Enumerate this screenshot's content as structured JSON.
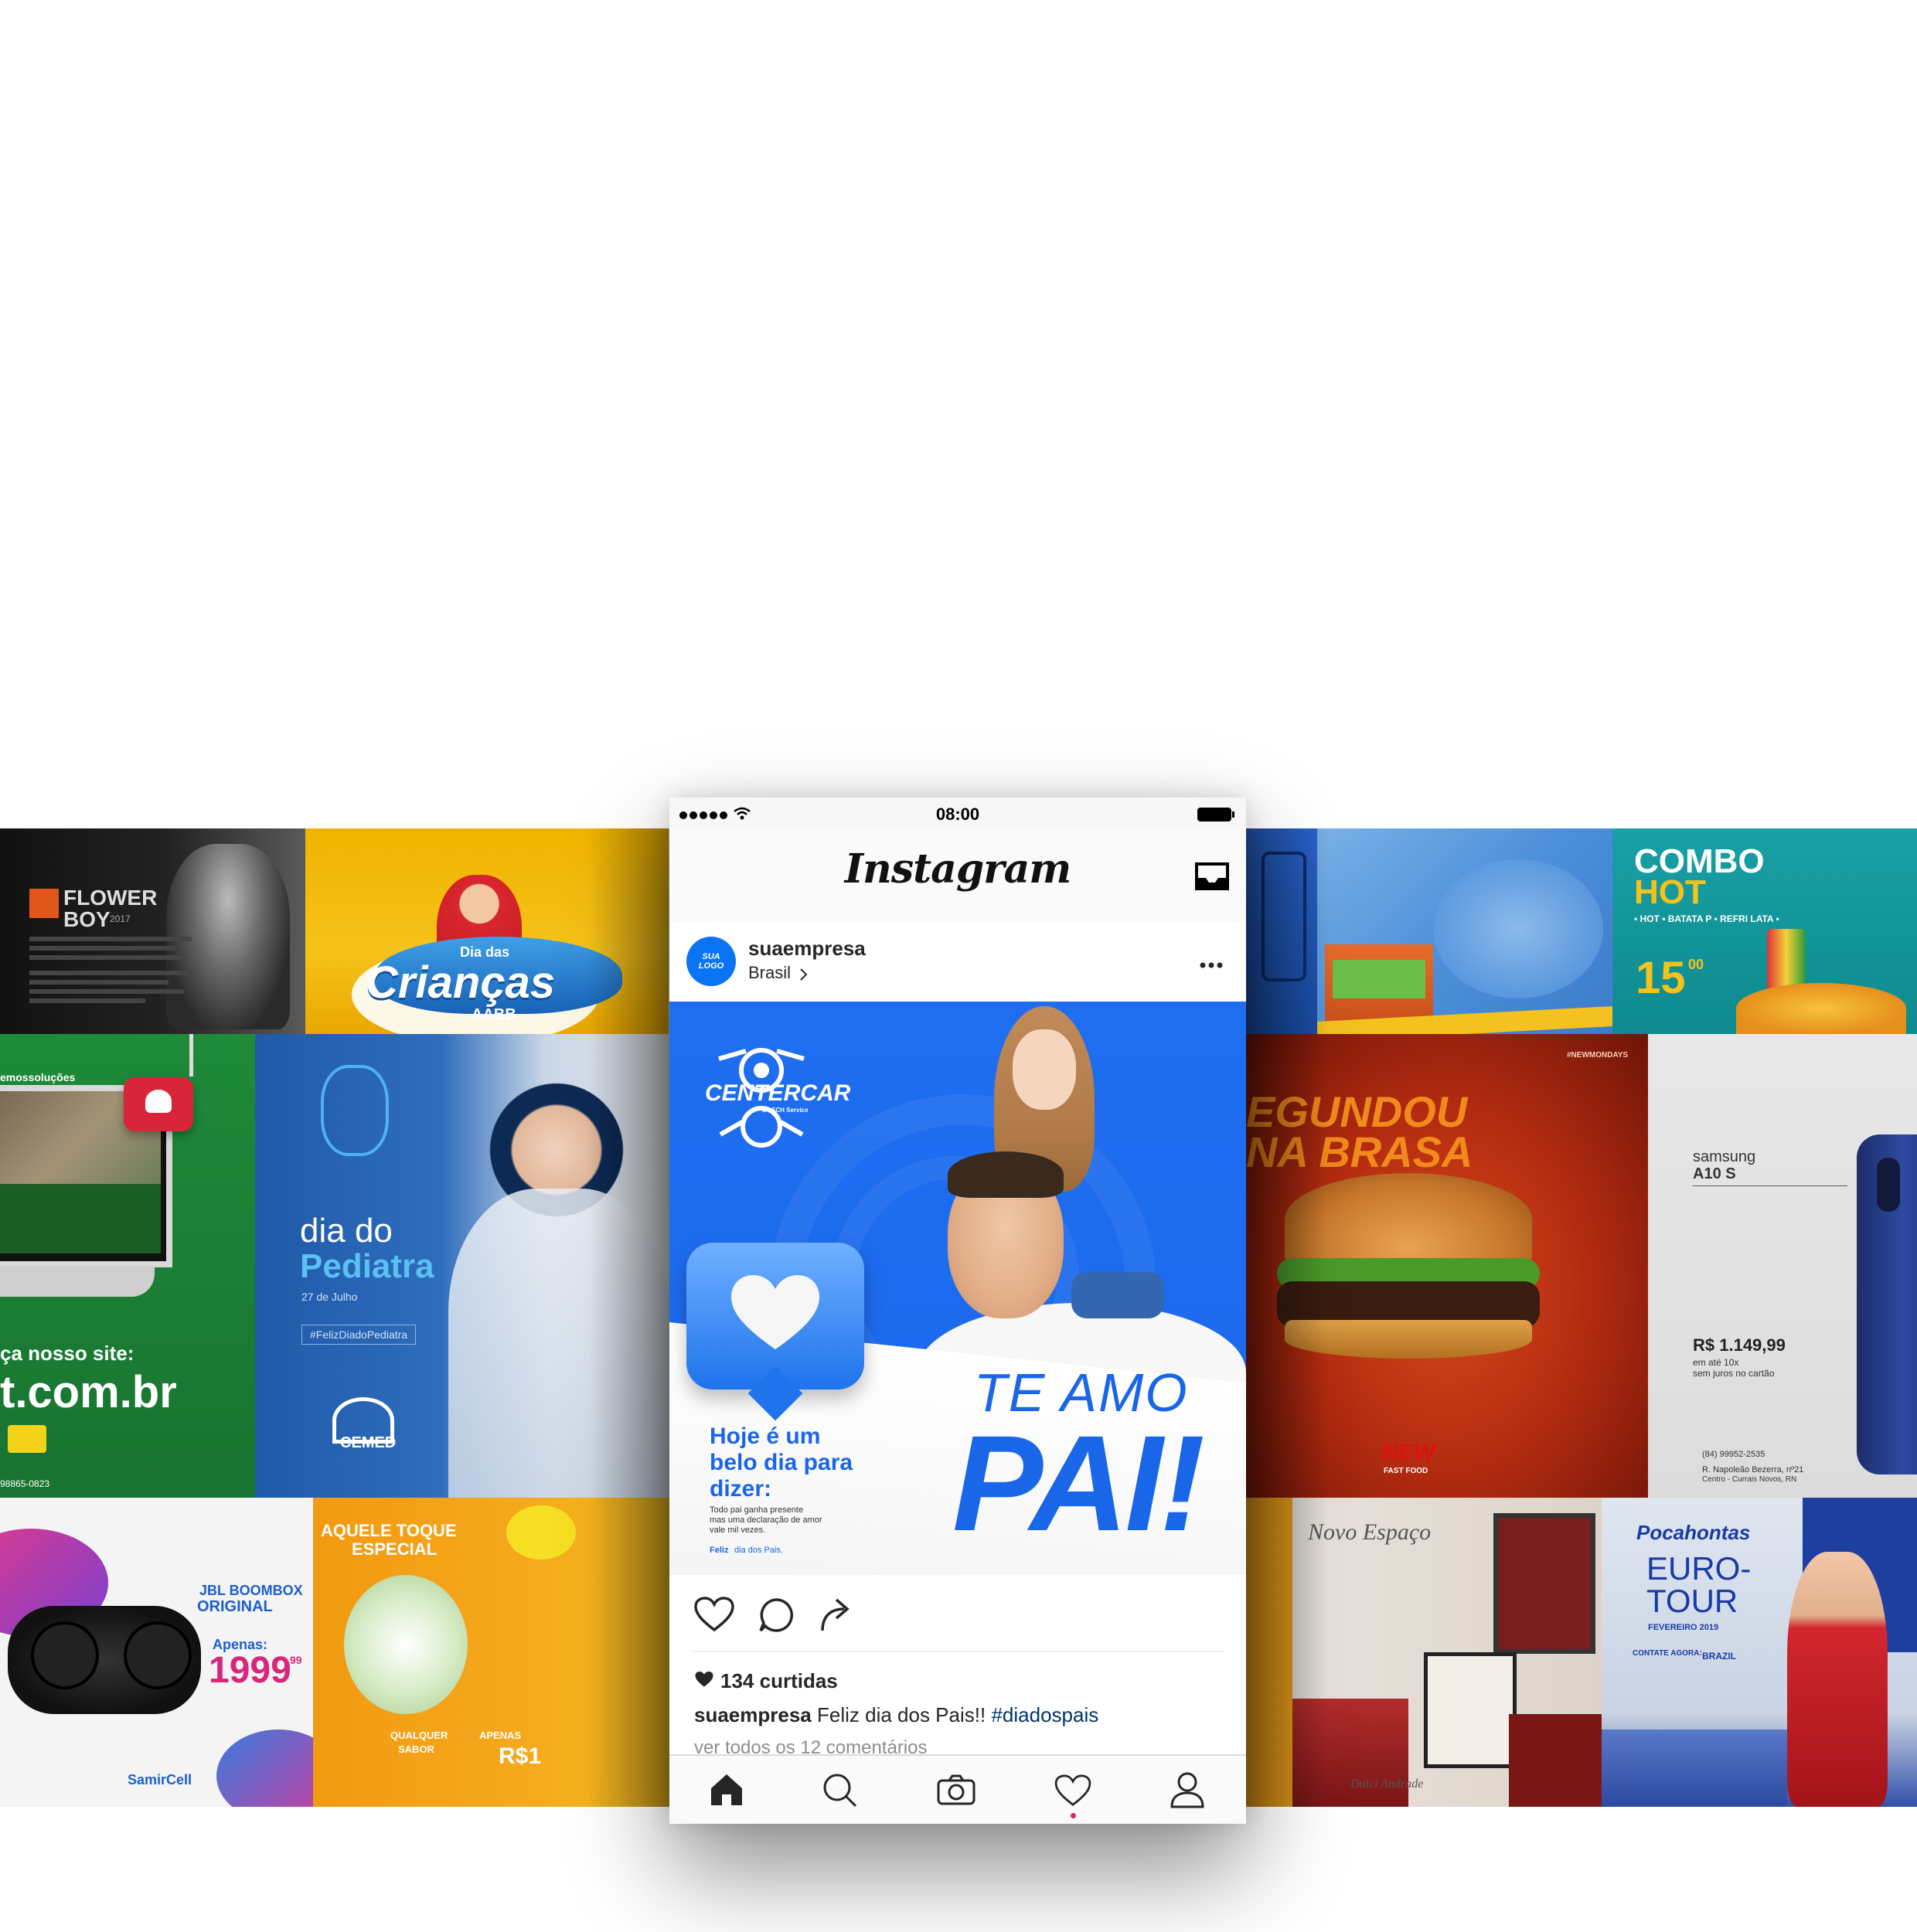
{
  "status_bar": {
    "time": "08:00"
  },
  "app": {
    "title": "Instagram"
  },
  "post": {
    "username": "suaempresa",
    "location": "Brasil",
    "avatar_text": "SUA LOGO",
    "brand": "CENTERCAR",
    "brand_sub": "BOSCH Service",
    "headline_1": "Hoje é um",
    "headline_2": "belo dia para",
    "headline_3": "dizer:",
    "small_1": "Todo pai ganha presente",
    "small_2": "mas uma declaração de amor",
    "small_3": "vale mil vezes.",
    "feliz": "Feliz",
    "feliz_rest": "dia dos Pais.",
    "te_amo": "TE AMO",
    "pai": "PAI!",
    "likes": "134 curtidas",
    "caption_user": "suaempresa",
    "caption_text": "Feliz dia dos Pais!!",
    "hashtag": "#diadospais",
    "comments_link": "ver todos os 12 comentários"
  },
  "tiles": {
    "flower_boy": {
      "title1": "FLOWER",
      "title2": "BOY",
      "year": "2017"
    },
    "criancas": {
      "pre": "Dia das",
      "title": "Crianças",
      "sub": "AABB"
    },
    "site": {
      "tag": "emossoluções",
      "cta": "ça nosso site:",
      "domain": "t.com.br",
      "phone": "98865-0823"
    },
    "pediatra": {
      "line1": "dia do",
      "line2": "Pediatra",
      "date": "27 de Julho",
      "hashtag": "#FelizDiadoPediatra",
      "logo": "CEMED"
    },
    "jbl": {
      "title1": "JBL BOOMBOX",
      "title2": "ORIGINAL",
      "apenas": "Apenas:",
      "price": "1999",
      "cents": "99",
      "store": "SamirCell"
    },
    "toque": {
      "line1": "AQUELE TOQUE",
      "line2": "ESPECIAL",
      "sub1": "QUALQUER",
      "sub2": "SABOR",
      "apenas": "APENAS",
      "price": "R$1"
    },
    "combo": {
      "line1": "COMBO",
      "line2": "HOT",
      "items": "• HOT • BATATA P • REFRI LATA •",
      "price": "15",
      "cents": "00"
    },
    "burger": {
      "tag": "#NEWMONDAYS",
      "line1": "EGUNDOU",
      "line2": "NA BRASA",
      "logo": "NEW",
      "logo_sub": "FAST FOOD"
    },
    "samsung": {
      "brand": "samsung",
      "model": "A10 S",
      "price": "R$ 1.149,99",
      "terms1": "em até 10x",
      "terms2": "sem juros no cartão",
      "phone": "(84) 99952-2535",
      "addr1": "R. Napoleão Bezerra, nº21",
      "addr2": "Centro - Currais Novos, RN"
    },
    "salon": {
      "title": "Novo Espaço",
      "name": "Dulci Andrade"
    },
    "tour": {
      "brand": "Pocahontas",
      "line1": "EURO-",
      "line2": "TOUR",
      "date": "FEVEREIRO 2019",
      "contact": "CONTATE AGORA:",
      "agency": "BRAZIL"
    }
  },
  "colors": {
    "instagram_blue": "#0a74f5",
    "accent_red": "#e0245e",
    "text_dark": "#262626",
    "muted": "#8e8e8e",
    "hashtag": "#003569"
  }
}
